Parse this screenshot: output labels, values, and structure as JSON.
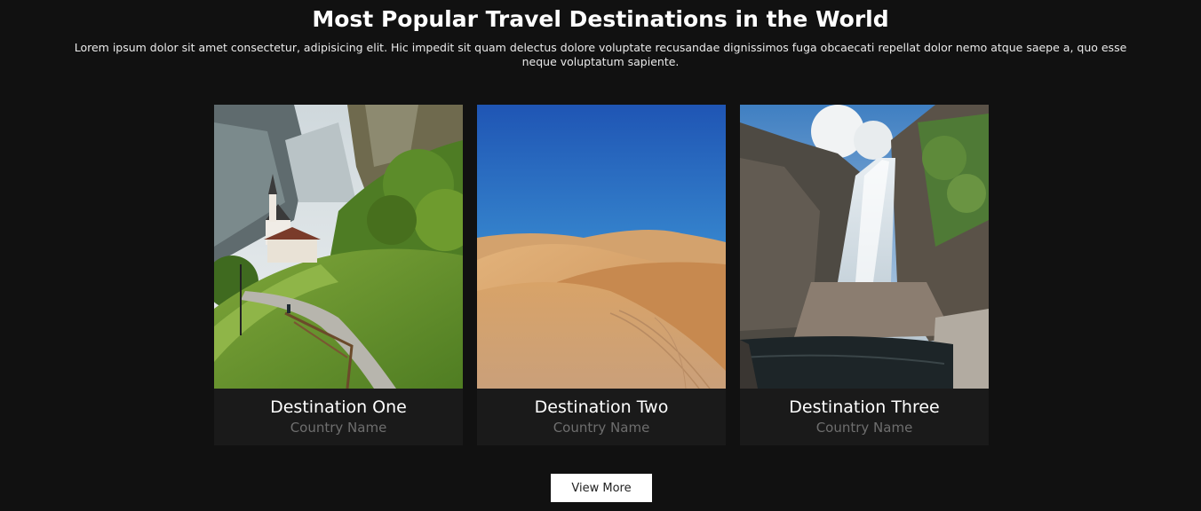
{
  "header": {
    "title": "Most Popular Travel Destinations in the World",
    "description": "Lorem ipsum dolor sit amet consectetur, adipisicing elit. Hic impedit sit quam delectus dolore voluptate recusandae dignissimos fuga obcaecati repellat dolor nemo atque saepe a, quo esse neque voluptatum sapiente."
  },
  "cards": [
    {
      "title": "Destination One",
      "country": "Country Name",
      "image": "alpine-village-valley-photo"
    },
    {
      "title": "Destination Two",
      "country": "Country Name",
      "image": "desert-dunes-photo"
    },
    {
      "title": "Destination Three",
      "country": "Country Name",
      "image": "waterfall-cliff-photo"
    }
  ],
  "button": {
    "label": "View More"
  },
  "colors": {
    "background": "#111111",
    "card": "#1a1a1a",
    "country_text": "#6e6e6e",
    "button_bg": "#ffffff"
  }
}
